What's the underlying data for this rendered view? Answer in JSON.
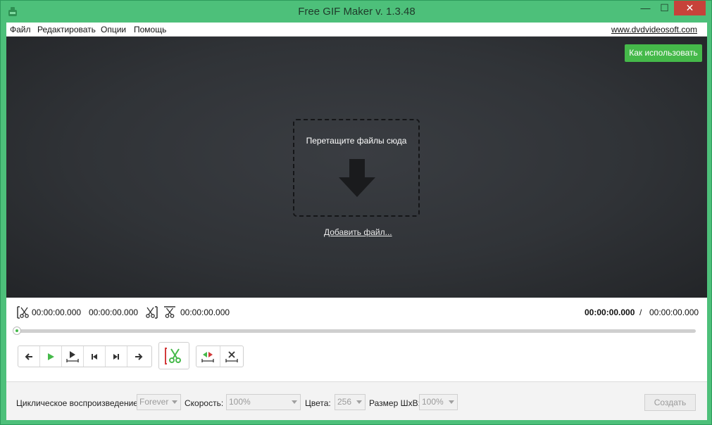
{
  "window": {
    "title": "Free GIF Maker v. 1.3.48",
    "minimize": "—",
    "maximize": "☐",
    "close": "✕"
  },
  "menu": {
    "items": [
      "Файл",
      "Редактировать",
      "Опции",
      "Помощь"
    ],
    "site_link": "www.dvdvideosoft.com"
  },
  "preview": {
    "howto_button": "Как использовать",
    "drop_text": "Перетащите файлы сюда",
    "add_file_link": "Добавить файл..."
  },
  "timeline": {
    "cut_start_time": "00:00:00.000",
    "cut_end_time": "00:00:00.000",
    "cut_length_time": "00:00:00.000",
    "current_time": "00:00:00.000",
    "separator": "/",
    "total_time": "00:00:00.000",
    "position": 0
  },
  "bottom": {
    "loop_label": "Циклическое воспроизведение:",
    "loop_value": "Forever",
    "speed_label": "Скорость:",
    "speed_value": "100%",
    "colors_label": "Цвета:",
    "colors_value": "256",
    "size_label": "Размер ШхВ:",
    "size_value": "100%",
    "create_button": "Создать"
  },
  "colors": {
    "accent": "#45b94a",
    "frame": "#4dc07a",
    "preview_bg": "#303337"
  }
}
